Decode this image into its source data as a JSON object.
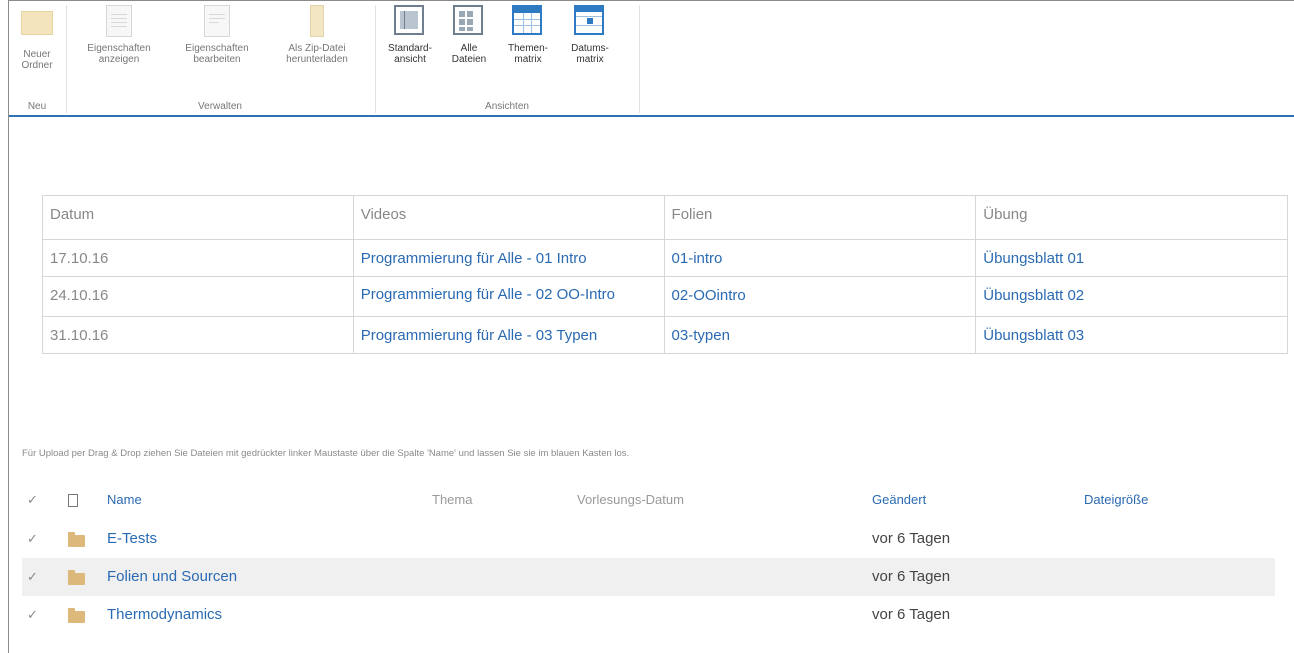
{
  "ribbon": {
    "groups": [
      {
        "label": "Neu",
        "buttons": [
          {
            "label": "Neuer Ordner",
            "icon": "folder-icon"
          }
        ]
      },
      {
        "label": "Verwalten",
        "buttons": [
          {
            "label": "Eigenschaften anzeigen",
            "icon": "properties-view-icon"
          },
          {
            "label": "Eigenschaften bearbeiten",
            "icon": "properties-edit-icon"
          },
          {
            "label": "Als Zip-Datei herunterladen",
            "icon": "zip-icon"
          }
        ]
      },
      {
        "label": "Ansichten",
        "buttons": [
          {
            "label": "Standard-ansicht",
            "icon": "standard-view-icon"
          },
          {
            "label": "Alle Dateien",
            "icon": "all-files-icon"
          },
          {
            "label": "Themen-matrix",
            "icon": "topic-matrix-icon"
          },
          {
            "label": "Datums-matrix",
            "icon": "date-matrix-icon"
          }
        ]
      }
    ],
    "accent_color": "#2a72b5"
  },
  "schedule": {
    "headers": [
      "Datum",
      "Videos",
      "Folien",
      "Übung"
    ],
    "rows": [
      {
        "date": "17.10.16",
        "video": "Programmierung für Alle - 01 Intro",
        "slides": "01-intro",
        "exercise": "Übungsblatt 01"
      },
      {
        "date": "24.10.16",
        "video": "Programmierung für Alle - 02 OO-Intro",
        "slides": "02-OOintro",
        "exercise": "Übungsblatt 02"
      },
      {
        "date": "31.10.16",
        "video": "Programmierung für Alle - 03 Typen",
        "slides": "03-typen",
        "exercise": "Übungsblatt 03"
      }
    ]
  },
  "upload_hint": "Für Upload per Drag & Drop ziehen Sie Dateien mit gedrückter linker Maustaste über die Spalte 'Name' und lassen Sie sie im blauen Kasten los.",
  "file_list": {
    "headers": {
      "check": "✓",
      "name": "Name",
      "thema": "Thema",
      "datum": "Vorlesungs-Datum",
      "modified": "Geändert",
      "size": "Dateigröße"
    },
    "rows": [
      {
        "check": "✓",
        "name": "E-Tests",
        "modified": "vor 6 Tagen"
      },
      {
        "check": "✓",
        "name": "Folien und Sourcen",
        "modified": "vor 6 Tagen"
      },
      {
        "check": "✓",
        "name": "Thermodynamics",
        "modified": "vor 6 Tagen"
      }
    ]
  },
  "link_color": "#2a6ab2"
}
